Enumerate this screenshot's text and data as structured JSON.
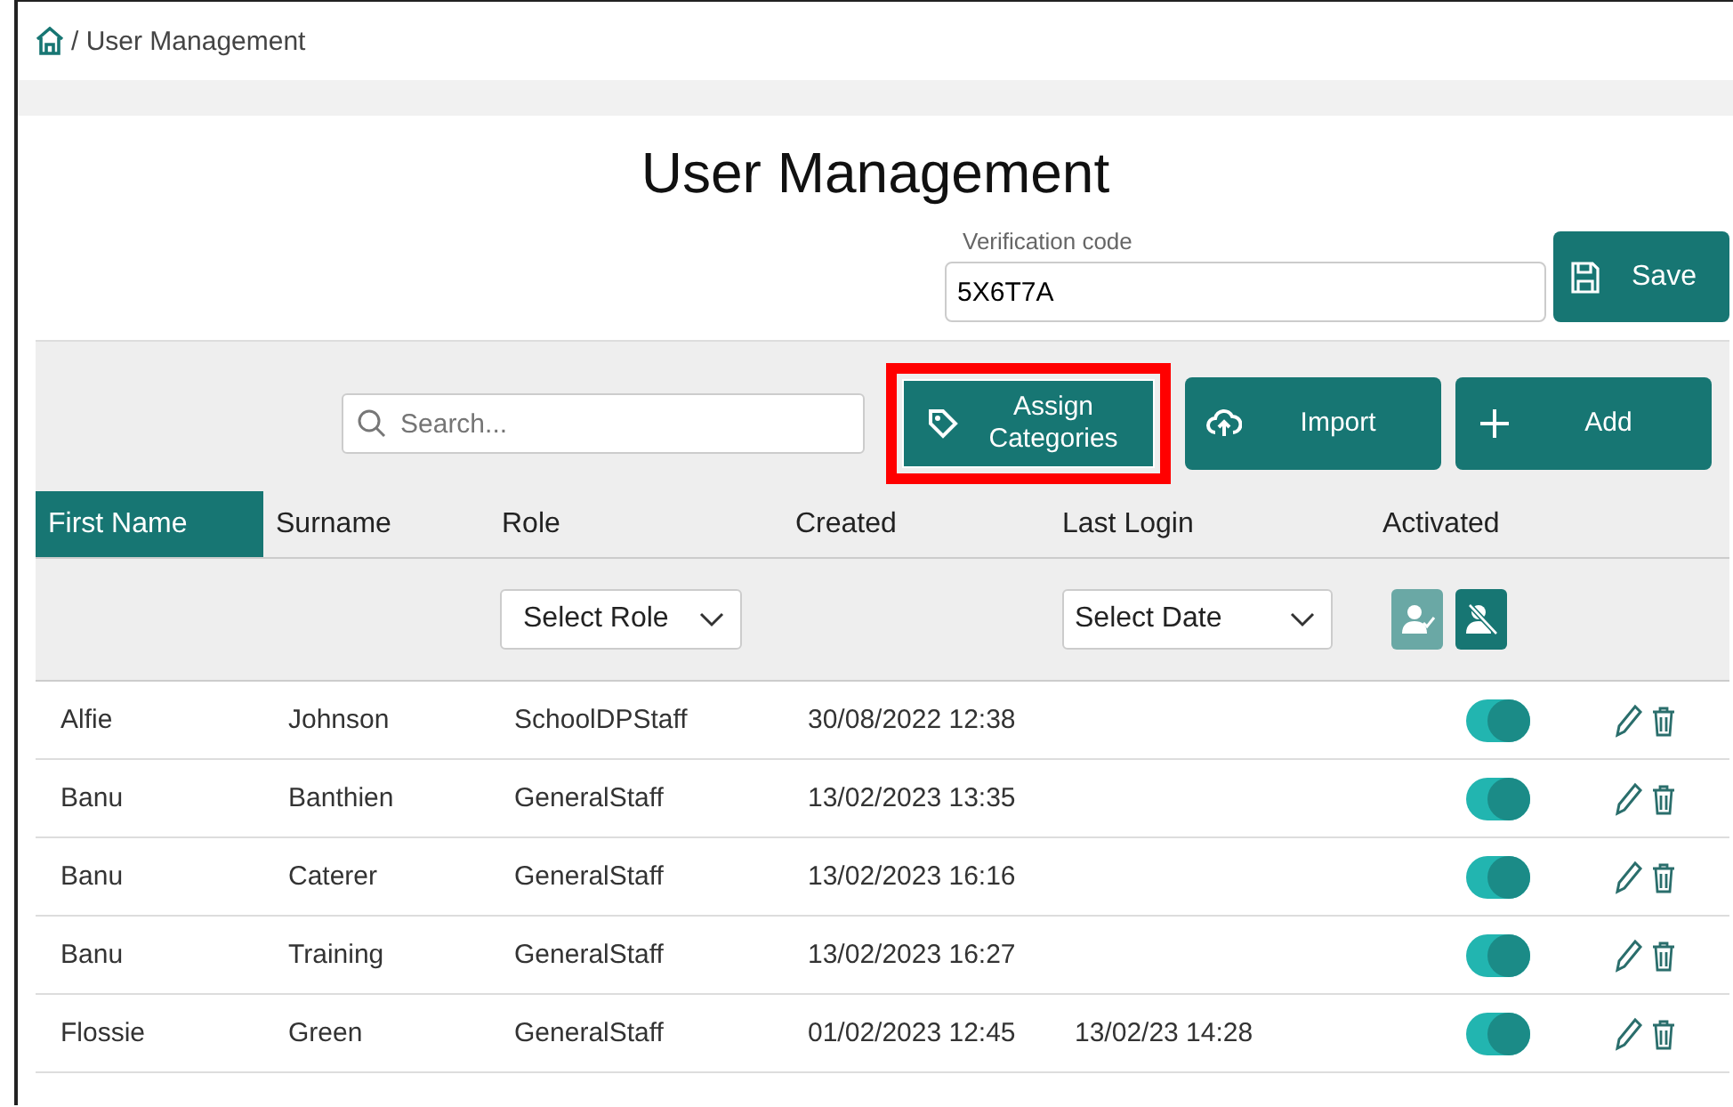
{
  "breadcrumb": {
    "current": "/ User Management"
  },
  "title": "User Management",
  "verification": {
    "label": "Verification code",
    "value": "5X6T7A"
  },
  "save_button": "Save",
  "search": {
    "placeholder": "Search..."
  },
  "toolbar_buttons": [
    {
      "kind": "tag",
      "label": "Assign Categories",
      "highlighted": true
    },
    {
      "kind": "upload",
      "label": "Import",
      "highlighted": false
    },
    {
      "kind": "plus",
      "label": "Add",
      "highlighted": false
    }
  ],
  "columns": [
    {
      "label": "First Name",
      "selected": true
    },
    {
      "label": "Surname",
      "selected": false
    },
    {
      "label": "Role",
      "selected": false
    },
    {
      "label": "Created",
      "selected": false
    },
    {
      "label": "Last Login",
      "selected": false
    },
    {
      "label": "Activated",
      "selected": false
    }
  ],
  "filters": {
    "role": "Select Role",
    "date": "Select Date",
    "status_buttons": [
      {
        "kind": "activated",
        "selected": false
      },
      {
        "kind": "deactivated",
        "selected": true
      }
    ]
  },
  "rows": [
    {
      "first_name": "Alfie",
      "surname": "Johnson",
      "role": "SchoolDPStaff",
      "created": "30/08/2022 12:38",
      "activated": true
    },
    {
      "first_name": "Banu",
      "surname": "Banthien",
      "role": "GeneralStaff",
      "created": "13/02/2023 13:35",
      "activated": true
    },
    {
      "first_name": "Banu",
      "surname": "Caterer",
      "role": "GeneralStaff",
      "created": "13/02/2023 16:16",
      "activated": true
    },
    {
      "first_name": "Banu",
      "surname": "Training",
      "role": "GeneralStaff",
      "created": "13/02/2023 16:27",
      "activated": true
    },
    {
      "first_name": "Flossie",
      "surname": "Green",
      "role": "GeneralStaff",
      "created": "01/02/2023 12:45",
      "last_login": "13/02/23 14:28",
      "activated": true
    }
  ]
}
